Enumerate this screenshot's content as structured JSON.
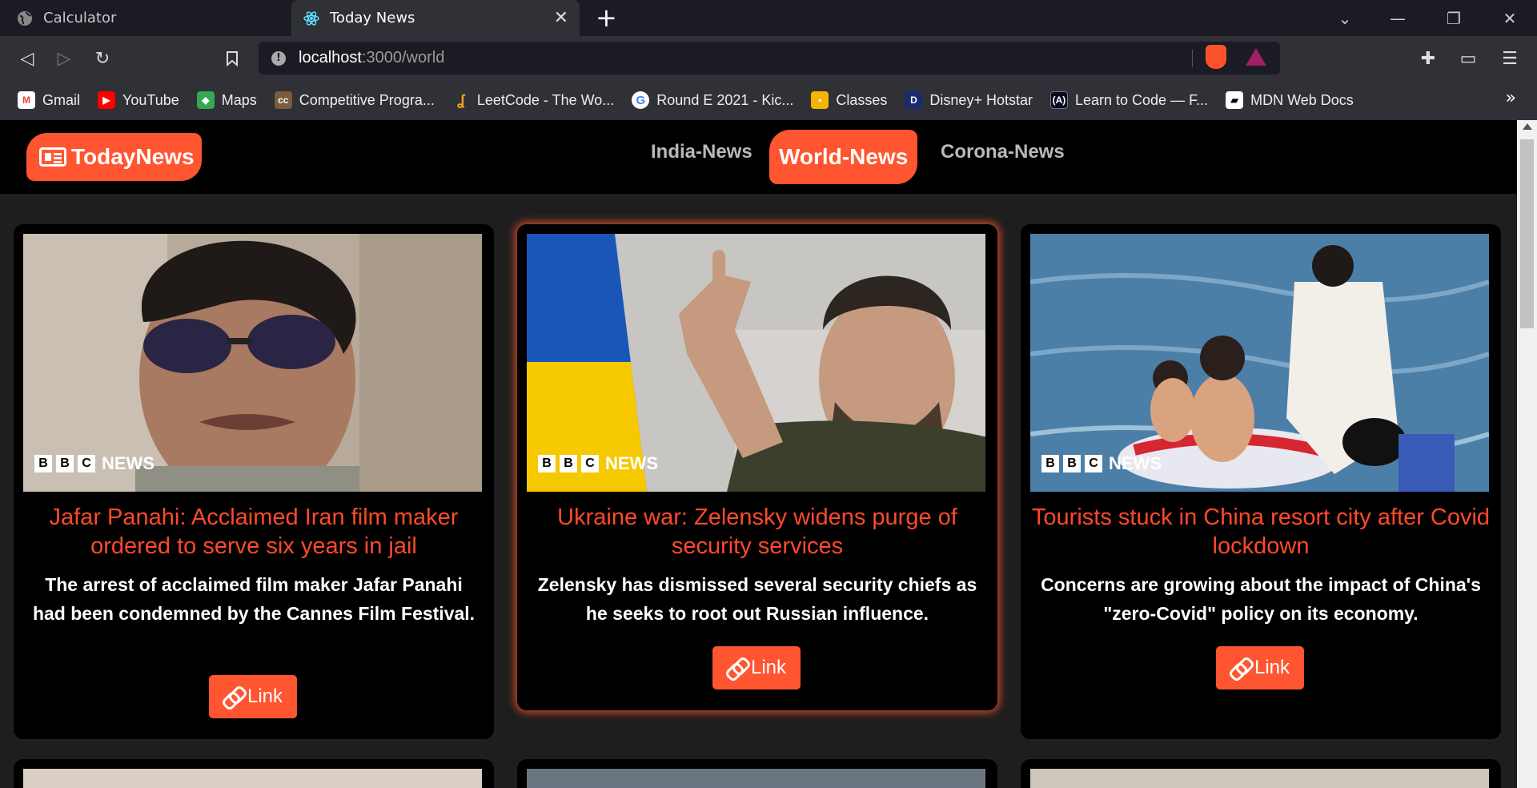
{
  "browser": {
    "tabs": [
      {
        "title": "Calculator",
        "icon": "globe-icon",
        "active": false
      },
      {
        "title": "Today News",
        "icon": "react-icon",
        "active": true
      }
    ],
    "url_host": "localhost",
    "url_path": ":3000/world",
    "bookmarks": [
      {
        "label": "Gmail",
        "icon": "gmail-icon",
        "color": "#ea4335"
      },
      {
        "label": "YouTube",
        "icon": "youtube-icon",
        "color": "#ff0000"
      },
      {
        "label": "Maps",
        "icon": "maps-icon",
        "color": "#34a853"
      },
      {
        "label": "Competitive Progra...",
        "icon": "cc-icon",
        "color": "#7a5c3d"
      },
      {
        "label": "LeetCode - The Wo...",
        "icon": "leetcode-icon",
        "color": "#f89f1b"
      },
      {
        "label": "Round E 2021 - Kic...",
        "icon": "google-icon",
        "color": "#4285f4"
      },
      {
        "label": "Classes",
        "icon": "classroom-icon",
        "color": "#f4b400"
      },
      {
        "label": "Disney+ Hotstar",
        "icon": "hotstar-icon",
        "color": "#1a2a6c"
      },
      {
        "label": "Learn to Code — F...",
        "icon": "freecodecamp-icon",
        "color": "#0a0a23"
      },
      {
        "label": "MDN Web Docs",
        "icon": "mdn-icon",
        "color": "#000000"
      }
    ]
  },
  "site": {
    "brand": "TodayNews",
    "nav": [
      "India-News",
      "World-News",
      "Corona-News"
    ],
    "active_nav": "World-News",
    "accent": "#ff5530"
  },
  "cards": [
    {
      "title": "Jafar Panahi: Acclaimed Iran film maker ordered to serve six years in jail",
      "description": "The arrest of acclaimed film maker Jafar Panahi had been condemned by the Cannes Film Festival.",
      "link_label": "Link",
      "source_badge": [
        "B",
        "B",
        "C",
        "NEWS"
      ]
    },
    {
      "title": "Ukraine war: Zelensky widens purge of security services",
      "description": "Zelensky has dismissed several security chiefs as he seeks to root out Russian influence.",
      "link_label": "Link",
      "source_badge": [
        "B",
        "B",
        "C",
        "NEWS"
      ]
    },
    {
      "title": "Tourists stuck in China resort city after Covid lockdown",
      "description": "Concerns are growing about the impact of China's \"zero-Covid\" policy on its economy.",
      "link_label": "Link",
      "source_badge": [
        "B",
        "B",
        "C",
        "NEWS"
      ]
    }
  ]
}
